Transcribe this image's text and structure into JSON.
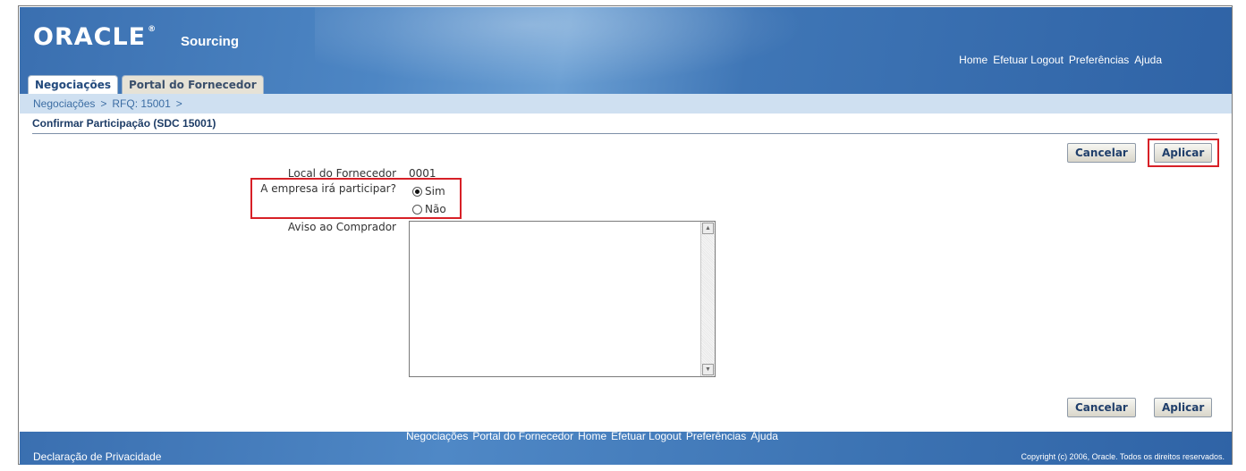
{
  "header": {
    "logo": "ORACLE",
    "logo_mark": "®",
    "product": "Sourcing",
    "global_links": [
      "Home",
      "Efetuar Logout",
      "Preferências",
      "Ajuda"
    ]
  },
  "tabs": [
    {
      "label": "Negociações",
      "active": true
    },
    {
      "label": "Portal do Fornecedor",
      "active": false
    }
  ],
  "breadcrumb": {
    "items": [
      "Negociações",
      "RFQ: 15001"
    ],
    "separator": ">"
  },
  "page": {
    "title": "Confirmar Participação (SDC 15001)"
  },
  "buttons": {
    "cancel": "Cancelar",
    "apply": "Aplicar"
  },
  "form": {
    "supplier_site_label": "Local do Fornecedor",
    "supplier_site_value": "0001",
    "participate_label": "A empresa irá participar?",
    "options": [
      {
        "label": "Sim",
        "checked": true
      },
      {
        "label": "Não",
        "checked": false
      }
    ],
    "notice_label": "Aviso ao Comprador",
    "notice_value": ""
  },
  "footer": {
    "links": [
      "Negociações",
      "Portal do Fornecedor",
      "Home",
      "Efetuar Logout",
      "Preferências",
      "Ajuda"
    ],
    "privacy": "Declaração de Privacidade",
    "copyright": "Copyright (c) 2006, Oracle. Todos os direitos reservados."
  },
  "colors": {
    "brand_blue": "#3a6fb0",
    "highlight_red": "#d72027",
    "link_blue": "#3c6da3"
  }
}
